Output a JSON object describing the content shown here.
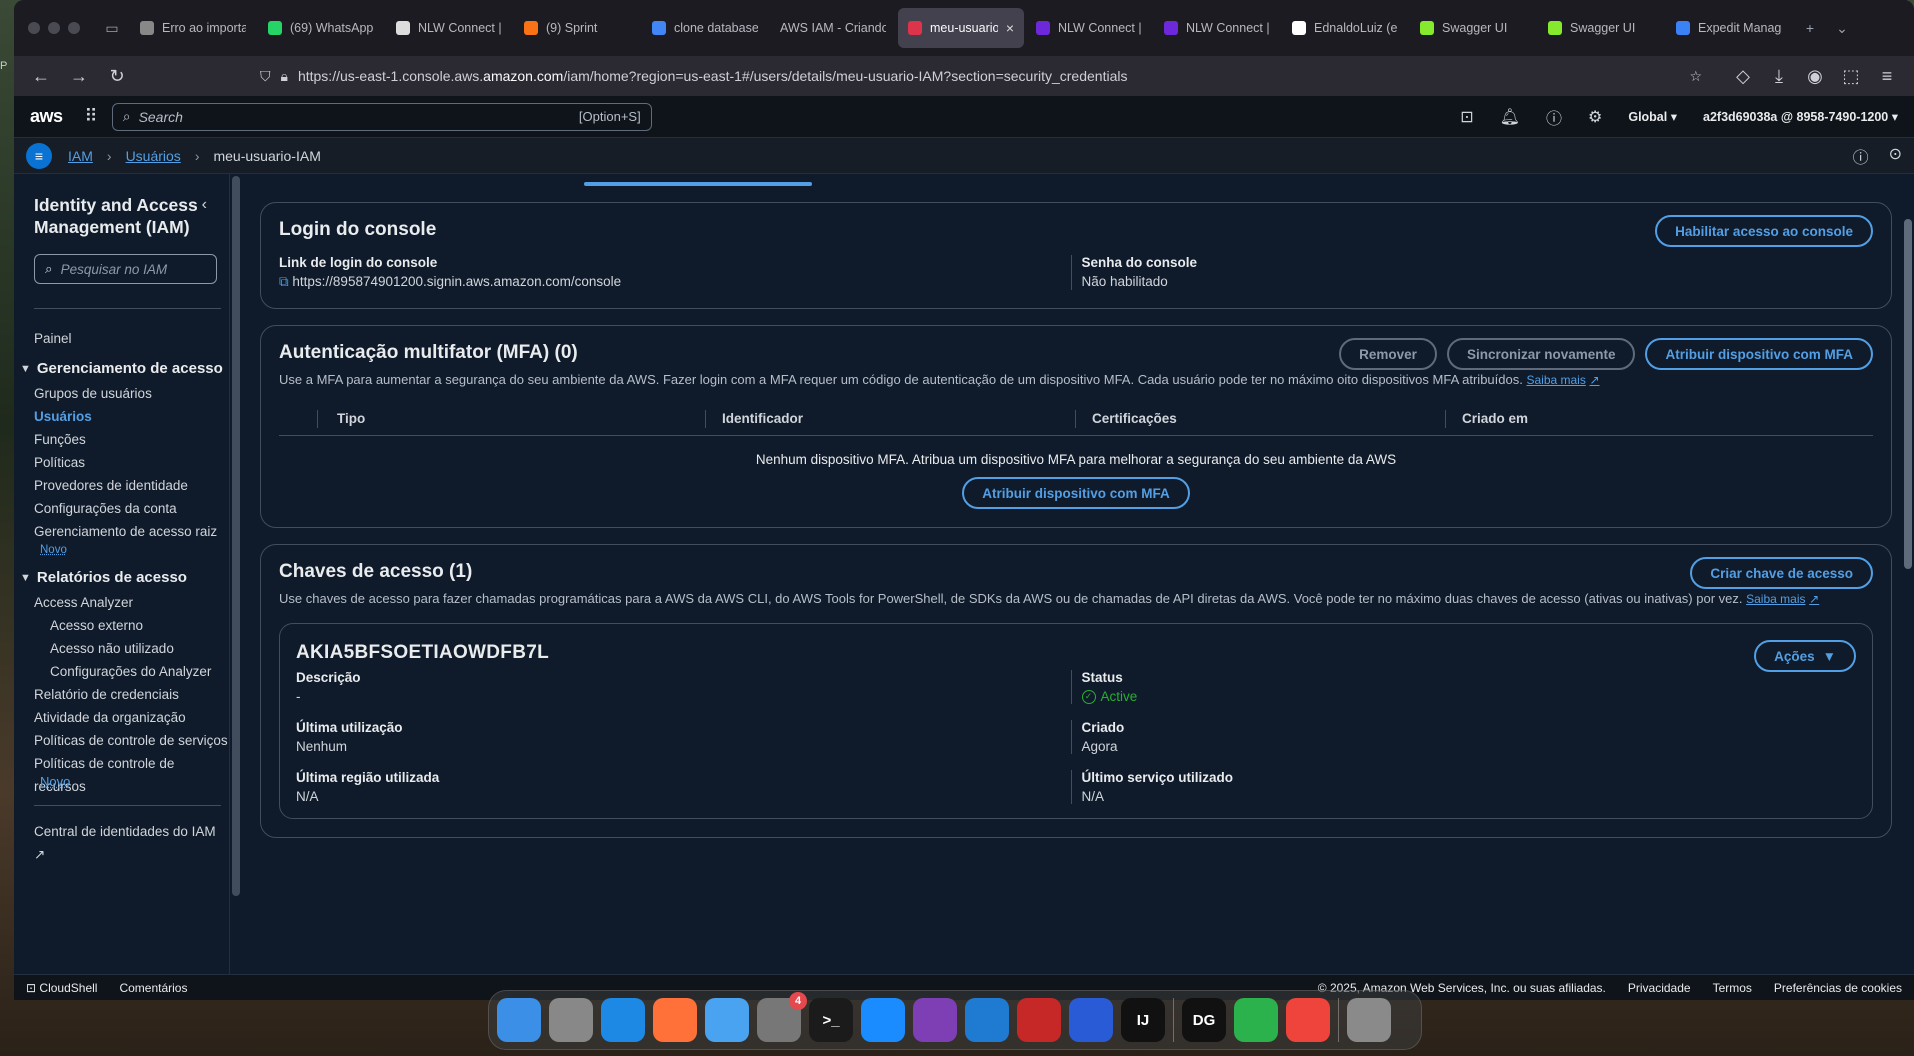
{
  "browser": {
    "tabs": [
      {
        "label": "Erro ao importa",
        "color": "#888888",
        "active": false
      },
      {
        "label": "(69) WhatsApp",
        "color": "#25d366",
        "active": false
      },
      {
        "label": "NLW Connect |",
        "color": "#dddddd",
        "active": false
      },
      {
        "label": "(9) Sprint",
        "color": "#f97316",
        "active": false
      },
      {
        "label": "clone database",
        "color": "#4285f4",
        "active": false
      },
      {
        "label": "AWS IAM - Criando",
        "color": "",
        "active": false
      },
      {
        "label": "meu-usuario",
        "color": "#dd344c",
        "active": true
      },
      {
        "label": "NLW Connect |",
        "color": "#6d28d9",
        "active": false
      },
      {
        "label": "NLW Connect |",
        "color": "#6d28d9",
        "active": false
      },
      {
        "label": "EdnaldoLuiz (e",
        "color": "#ffffff",
        "active": false
      },
      {
        "label": "Swagger UI",
        "color": "#85ea2d",
        "active": false
      },
      {
        "label": "Swagger UI",
        "color": "#85ea2d",
        "active": false
      },
      {
        "label": "Expedit Manage",
        "color": "#3b82f6",
        "active": false
      }
    ],
    "url_prefix": "https://us-east-1.console.aws.",
    "url_host": "amazon.com",
    "url_suffix": "/iam/home?region=us-east-1#/users/details/meu-usuario-IAM?section=security_credentials"
  },
  "aws_header": {
    "logo": "aws",
    "search_placeholder": "Search",
    "search_shortcut": "[Option+S]",
    "region": "Global",
    "account": "a2f3d69038a @ 8958-7490-1200"
  },
  "breadcrumb": {
    "items": [
      "IAM",
      "Usuários"
    ],
    "current": "meu-usuario-IAM"
  },
  "sidebar": {
    "title": "Identity and Access Management (IAM)",
    "search_placeholder": "Pesquisar no IAM",
    "painel": "Painel",
    "section1": "Gerenciamento de acesso",
    "section1_items": [
      "Grupos de usuários",
      "Usuários",
      "Funções",
      "Políticas",
      "Provedores de identidade",
      "Configurações da conta",
      "Gerenciamento de acesso raiz"
    ],
    "new_badge": "Novo",
    "section2": "Relatórios de acesso",
    "access_analyzer": "Access Analyzer",
    "analyzer_items": [
      "Acesso externo",
      "Acesso não utilizado",
      "Configurações do Analyzer"
    ],
    "section2_items": [
      "Relatório de credenciais",
      "Atividade da organização",
      "Políticas de controle de serviços",
      "Políticas de controle de recursos"
    ],
    "identity_center": "Central de identidades do IAM"
  },
  "console_login": {
    "title": "Login do console",
    "enable_button": "Habilitar acesso ao console",
    "link_label": "Link de login do console",
    "link_value": "https://895874901200.signin.aws.amazon.com/console",
    "password_label": "Senha do console",
    "password_value": "Não habilitado"
  },
  "mfa": {
    "title": "Autenticação multifator (MFA) (0)",
    "remove_button": "Remover",
    "resync_button": "Sincronizar novamente",
    "assign_button": "Atribuir dispositivo com MFA",
    "description": "Use a MFA para aumentar a segurança do seu ambiente da AWS. Fazer login com a MFA requer um código de autenticação de um dispositivo MFA. Cada usuário pode ter no máximo oito dispositivos MFA atribuídos.",
    "learn_more": "Saiba mais",
    "columns": [
      "Tipo",
      "Identificador",
      "Certificações",
      "Criado em"
    ],
    "empty_message": "Nenhum dispositivo MFA. Atribua um dispositivo MFA para melhorar a segurança do seu ambiente da AWS",
    "empty_assign_button": "Atribuir dispositivo com MFA"
  },
  "access_keys": {
    "title": "Chaves de acesso (1)",
    "create_button": "Criar chave de acesso",
    "description": "Use chaves de acesso para fazer chamadas programáticas para a AWS da AWS CLI, do AWS Tools for PowerShell, de SDKs da AWS ou de chamadas de API diretas da AWS. Você pode ter no máximo duas chaves de acesso (ativas ou inativas) por vez.",
    "learn_more": "Saiba mais",
    "key": {
      "id": "AKIA5BFSOETIAOWDFB7L",
      "actions_button": "Ações",
      "description_label": "Descrição",
      "description_value": "-",
      "status_label": "Status",
      "status_value": "Active",
      "last_used_label": "Última utilização",
      "last_used_value": "Nenhum",
      "created_label": "Criado",
      "created_value": "Agora",
      "last_region_label": "Última região utilizada",
      "last_region_value": "N/A",
      "last_service_label": "Último serviço utilizado",
      "last_service_value": "N/A"
    }
  },
  "footer": {
    "cloudshell": "CloudShell",
    "feedback": "Comentários",
    "copyright": "© 2025, Amazon Web Services, Inc. ou suas afiliadas.",
    "privacy": "Privacidade",
    "terms": "Termos",
    "cookies": "Preferências de cookies"
  },
  "dock": {
    "apps": [
      {
        "name": "finder",
        "label": "",
        "color": "#3b8fe6"
      },
      {
        "name": "launchpad",
        "label": "",
        "color": "#888888"
      },
      {
        "name": "safari",
        "label": "",
        "color": "#1e88e5"
      },
      {
        "name": "firefox",
        "label": "",
        "color": "#ff7139"
      },
      {
        "name": "mail",
        "label": "",
        "color": "#4aa3f0"
      },
      {
        "name": "system-settings",
        "label": "",
        "color": "#777777",
        "badge": "4"
      },
      {
        "name": "terminal",
        "label": ">_",
        "color": "#1b1b1b"
      },
      {
        "name": "app-store",
        "label": "",
        "color": "#1a8cff"
      },
      {
        "name": "github-desktop",
        "label": "",
        "color": "#7e3fb5"
      },
      {
        "name": "vscode",
        "label": "",
        "color": "#1f7bd2"
      },
      {
        "name": "database",
        "label": "",
        "color": "#c62828"
      },
      {
        "name": "firefox-dev",
        "label": "",
        "color": "#2a5bd7"
      },
      {
        "name": "intellij",
        "label": "IJ",
        "color": "#111111"
      },
      {
        "name": "datagrip",
        "label": "DG",
        "color": "#111111"
      },
      {
        "name": "numbers",
        "label": "",
        "color": "#2bb24c"
      },
      {
        "name": "anydesk",
        "label": "",
        "color": "#ef443b"
      },
      {
        "name": "trash",
        "label": "",
        "color": "#8a8a8a"
      }
    ]
  }
}
